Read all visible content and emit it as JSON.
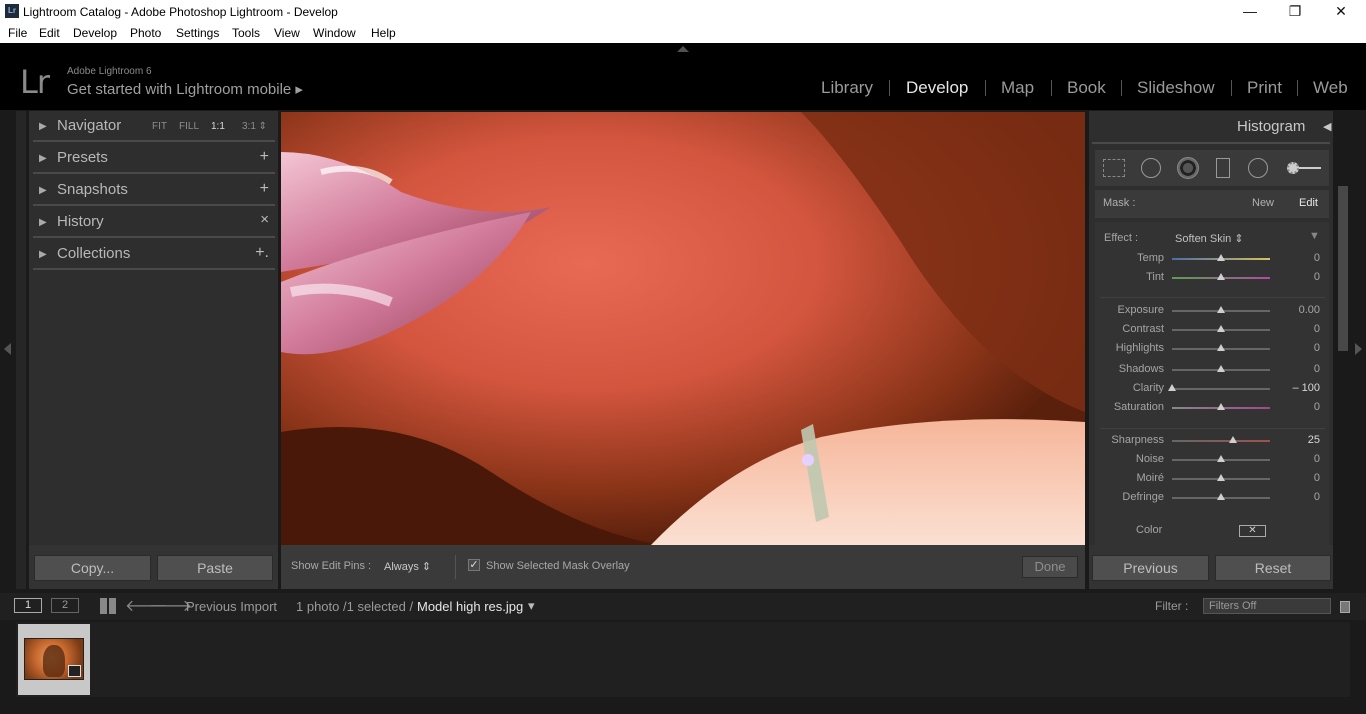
{
  "window": {
    "title": "Lightroom Catalog - Adobe Photoshop Lightroom - Develop",
    "app_icon": "Lr",
    "minimize": "—",
    "restore": "❐",
    "close": "✕"
  },
  "menu": [
    "File",
    "Edit",
    "Develop",
    "Photo",
    "Settings",
    "Tools",
    "View",
    "Window",
    "Help"
  ],
  "identity": {
    "logo": "Lr",
    "version": "Adobe Lightroom 6",
    "mobile": "Get started with Lightroom mobile ▸"
  },
  "modules": [
    "Library",
    "Develop",
    "Map",
    "Book",
    "Slideshow",
    "Print",
    "Web"
  ],
  "active_module": "Develop",
  "left_panels": {
    "navigator": {
      "label": "Navigator",
      "zoom": [
        "FIT",
        "FILL",
        "1:1",
        "3:1 ⇕"
      ]
    },
    "presets": {
      "label": "Presets",
      "action": "+"
    },
    "snapshots": {
      "label": "Snapshots",
      "action": "+"
    },
    "history": {
      "label": "History",
      "action": "×"
    },
    "collections": {
      "label": "Collections",
      "action": "+."
    }
  },
  "left_buttons": {
    "copy": "Copy...",
    "paste": "Paste"
  },
  "toolbar": {
    "pins_label": "Show Edit Pins :",
    "pins_value": "Always ⇕",
    "overlay_label": "Show Selected Mask Overlay",
    "overlay_checked": true,
    "done": "Done"
  },
  "right_panel": {
    "header": "Histogram",
    "header_tri": "◀",
    "mask_label": "Mask :",
    "mask_new": "New",
    "mask_edit": "Edit",
    "effect_label": "Effect :",
    "effect_value": "Soften Skin ⇕",
    "effect_toggle": "▼",
    "sliders": [
      {
        "label": "Temp",
        "value": "0",
        "pos": 0.5
      },
      {
        "label": "Tint",
        "value": "0",
        "pos": 0.5
      },
      {
        "label": "Exposure",
        "value": "0.00",
        "pos": 0.5
      },
      {
        "label": "Contrast",
        "value": "0",
        "pos": 0.5
      },
      {
        "label": "Highlights",
        "value": "0",
        "pos": 0.5
      },
      {
        "label": "Shadows",
        "value": "0",
        "pos": 0.5
      },
      {
        "label": "Clarity",
        "value": "– 100",
        "pos": 0.0
      },
      {
        "label": "Saturation",
        "value": "0",
        "pos": 0.5
      },
      {
        "label": "Sharpness",
        "value": "25",
        "pos": 0.62
      },
      {
        "label": "Noise",
        "value": "0",
        "pos": 0.5
      },
      {
        "label": "Moiré",
        "value": "0",
        "pos": 0.5
      },
      {
        "label": "Defringe",
        "value": "0",
        "pos": 0.5
      }
    ],
    "color_label": "Color",
    "previous": "Previous",
    "reset": "Reset"
  },
  "filmstrip": {
    "screen1": "1",
    "screen2": "2",
    "source": "Previous Import",
    "count": "1 photo /1 selected /",
    "filename": "Model high res.jpg",
    "dropdown": "▾",
    "filter_label": "Filter :",
    "filter_value": "Filters Off"
  },
  "colors": {
    "accent": "#c8c8c8",
    "panel": "#2e2e2e",
    "bg": "#1a1a1a"
  }
}
